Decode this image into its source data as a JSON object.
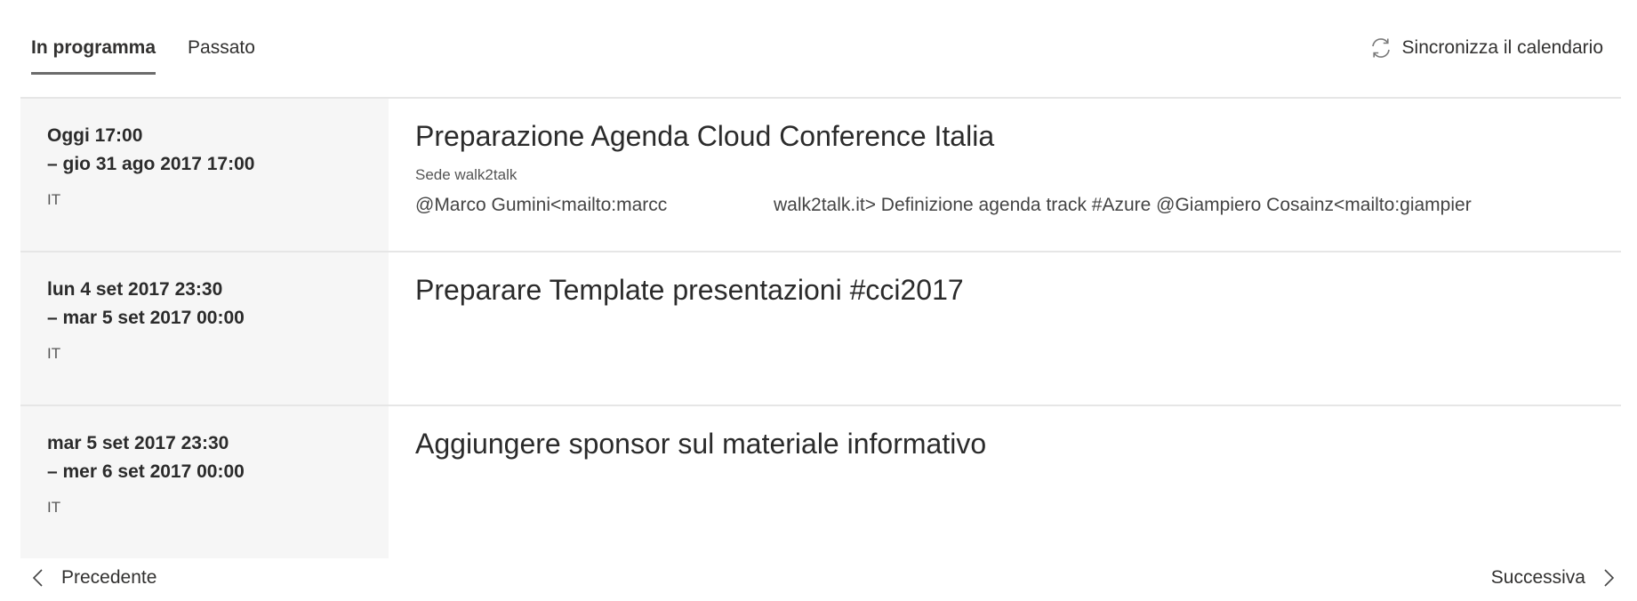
{
  "tabs": [
    {
      "label": "In programma",
      "active": true
    },
    {
      "label": "Passato",
      "active": false
    }
  ],
  "sync": {
    "label": "Sincronizza il calendario",
    "icon": "sync-icon"
  },
  "events": [
    {
      "date_start": "Oggi 17:00",
      "date_end": "– gio 31 ago 2017 17:00",
      "tz": "IT",
      "title": "Preparazione Agenda Cloud Conference Italia",
      "location": "Sede walk2talk",
      "body_part1": "@Marco Gumini<mailto:marcc",
      "body_part2": "walk2talk.it> Definizione agenda track #Azure @Giampiero Cosainz<mailto:giampier"
    },
    {
      "date_start": "lun 4 set 2017 23:30",
      "date_end": "– mar 5 set 2017 00:00",
      "tz": "IT",
      "title": "Preparare Template presentazioni #cci2017"
    },
    {
      "date_start": "mar 5 set 2017 23:30",
      "date_end": "– mer 6 set 2017 00:00",
      "tz": "IT",
      "title": "Aggiungere sponsor sul materiale informativo"
    }
  ],
  "pager": {
    "prev_label": "Precedente",
    "next_label": "Successiva"
  }
}
